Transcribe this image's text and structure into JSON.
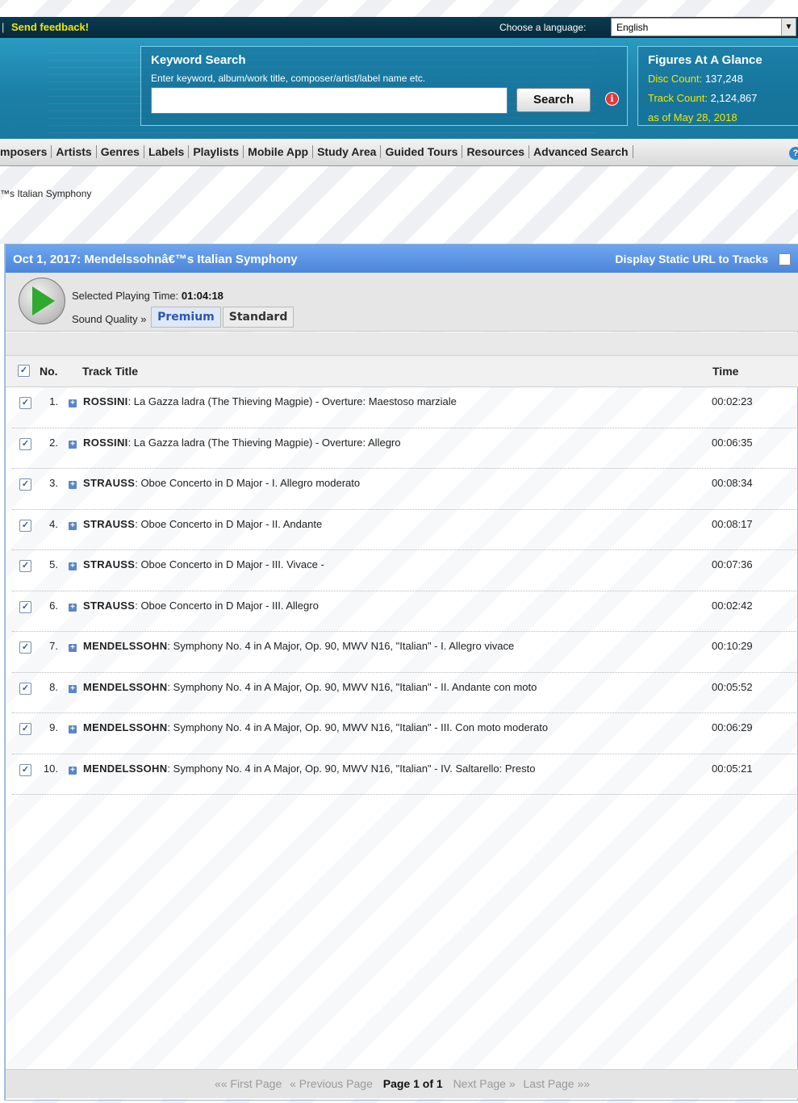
{
  "topbar": {
    "separator": "|",
    "feedback": "Send feedback!",
    "language_label": "Choose a language:",
    "language_value": "English",
    "dropdown_arrow": "▼"
  },
  "search": {
    "title": "Keyword Search",
    "hint": "Enter keyword, album/work title, composer/artist/label name etc.",
    "input_value": "",
    "button": "Search",
    "info_icon": "i"
  },
  "figures": {
    "title": "Figures At A Glance",
    "disc_label": "Disc Count:",
    "disc_value": "137,248",
    "track_label": "Track Count:",
    "track_value": "2,124,867",
    "date": "as of May 28, 2018"
  },
  "nav": {
    "items": [
      "mposers",
      "Artists",
      "Genres",
      "Labels",
      "Playlists",
      "Mobile App",
      "Study Area",
      "Guided Tours",
      "Resources",
      "Advanced Search"
    ],
    "help_icon": "?"
  },
  "breadcrumb": "™s Italian Symphony",
  "playlist": {
    "title": "Oct 1, 2017: Mendelssohnâ€™s Italian Symphony",
    "static_url_label": "Display Static URL to Tracks",
    "playing_time_label": "Selected Playing Time:",
    "playing_time_value": "01:04:18",
    "quality_label": "Sound Quality »",
    "quality_premium": "Premium",
    "quality_standard": "Standard",
    "colors": {
      "header": "#5a93e3",
      "premium": "#2a57b6",
      "play": "#2eaa2e"
    }
  },
  "table": {
    "headers": {
      "no": "No.",
      "title": "Track Title",
      "time": "Time"
    },
    "tracks": [
      {
        "no": "1.",
        "composer": "ROSSINI",
        "title": ": La Gazza ladra (The Thieving Magpie) - Overture: Maestoso marziale",
        "time": "00:02:23"
      },
      {
        "no": "2.",
        "composer": "ROSSINI",
        "title": ": La Gazza ladra (The Thieving Magpie) - Overture: Allegro",
        "time": "00:06:35"
      },
      {
        "no": "3.",
        "composer": "STRAUSS",
        "title": ": Oboe Concerto in D Major - I. Allegro moderato",
        "time": "00:08:34"
      },
      {
        "no": "4.",
        "composer": "STRAUSS",
        "title": ": Oboe Concerto in D Major - II. Andante",
        "time": "00:08:17"
      },
      {
        "no": "5.",
        "composer": "STRAUSS",
        "title": ": Oboe Concerto in D Major - III. Vivace -",
        "time": "00:07:36"
      },
      {
        "no": "6.",
        "composer": "STRAUSS",
        "title": ": Oboe Concerto in D Major - III. Allegro",
        "time": "00:02:42"
      },
      {
        "no": "7.",
        "composer": "MENDELSSOHN",
        "title": ": Symphony No. 4 in A Major, Op. 90, MWV N16, \"Italian\" - I. Allegro vivace",
        "time": "00:10:29"
      },
      {
        "no": "8.",
        "composer": "MENDELSSOHN",
        "title": ": Symphony No. 4 in A Major, Op. 90, MWV N16, \"Italian\" - II. Andante con moto",
        "time": "00:05:52"
      },
      {
        "no": "9.",
        "composer": "MENDELSSOHN",
        "title": ": Symphony No. 4 in A Major, Op. 90, MWV N16, \"Italian\" - III. Con moto moderato",
        "time": "00:06:29"
      },
      {
        "no": "10.",
        "composer": "MENDELSSOHN",
        "title": ": Symphony No. 4 in A Major, Op. 90, MWV N16, \"Italian\" - IV. Saltarello: Presto",
        "time": "00:05:21"
      }
    ]
  },
  "pager": {
    "first": "«« First Page",
    "prev": "« Previous Page",
    "current": "Page 1 of 1",
    "next": "Next Page »",
    "last": "Last Page »»"
  }
}
